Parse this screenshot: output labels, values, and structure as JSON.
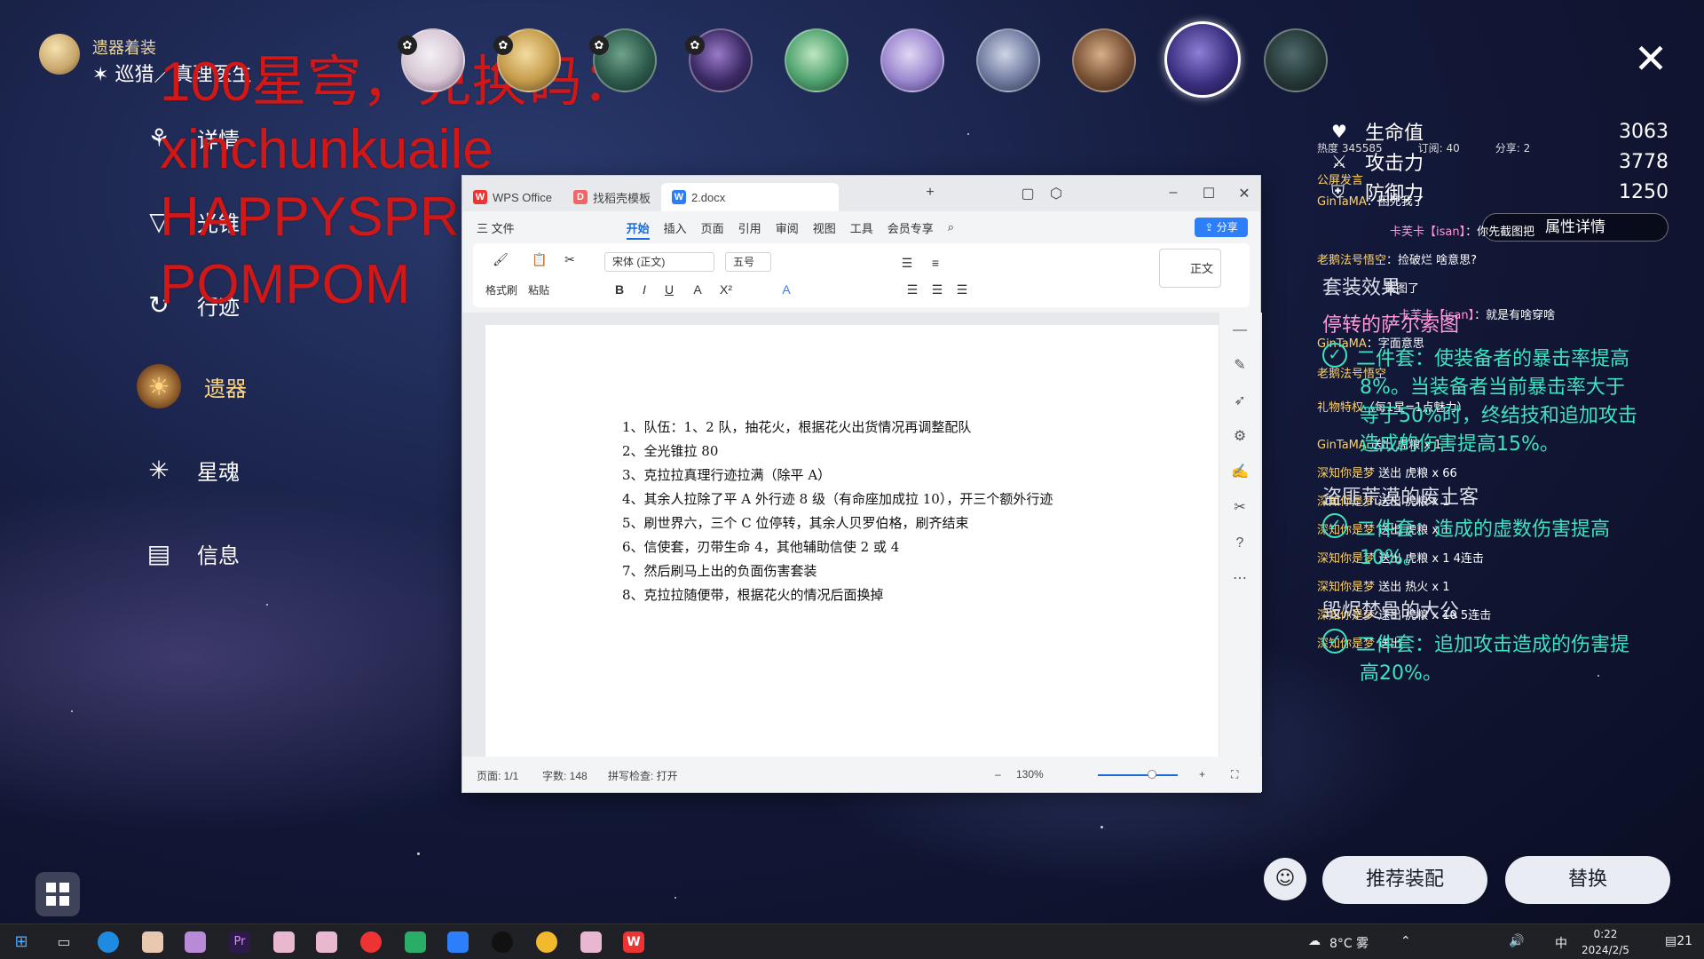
{
  "character": {
    "title": "遗器着装",
    "path": "巡猎／真理医生"
  },
  "overlay_text": [
    "100星穹，兑换码：",
    "xinchunkuaile",
    "HAPPYSPRINGFES",
    "POMPOM"
  ],
  "menu": [
    {
      "label": "详情",
      "icon": "detail-icon"
    },
    {
      "label": "光锥",
      "icon": "lightcone-icon"
    },
    {
      "label": "行迹",
      "icon": "trace-icon"
    },
    {
      "label": "遗器",
      "icon": "relic-icon",
      "active": true
    },
    {
      "label": "星魂",
      "icon": "eidolon-icon"
    },
    {
      "label": "信息",
      "icon": "info-icon"
    }
  ],
  "stats": [
    {
      "label": "生命值",
      "value": "3063",
      "icon": "heart-icon"
    },
    {
      "label": "攻击力",
      "value": "3778",
      "icon": "sword-icon"
    },
    {
      "label": "防御力",
      "value": "1250",
      "icon": "shield-icon"
    }
  ],
  "attr_detail_button": "属性详情",
  "live_stats": {
    "hot": "热度 345585",
    "sub": "订阅: 40",
    "share": "分享: 2"
  },
  "chat": [
    {
      "user": "公屏发言",
      "msg": ""
    },
    {
      "user": "GinTaMA",
      "msg": "：困死我了"
    },
    {
      "user": "卡芙卡【isan】",
      "msg": "：你先截图把"
    },
    {
      "user": "老鹅法号悟空",
      "msg": "：捡破烂 啥意思?"
    },
    {
      "user": "",
      "msg": "截图了"
    },
    {
      "user": "卡芙卡【isan】",
      "msg": "：就是有啥穿啥"
    },
    {
      "user": "GinTaMA",
      "msg": "：字面意思"
    },
    {
      "user": "老鹅法号悟空",
      "msg": ""
    },
    {
      "user": "礼物特权",
      "msg": "（每1星=1点魅力）"
    },
    {
      "user": "GinTaMA",
      "msg": "送出 虎粮 x 1"
    },
    {
      "user": "深知你是梦",
      "msg": "送出 虎粮 x 66"
    },
    {
      "user": "深知你是梦",
      "msg": "送出 虎粮 x 1"
    },
    {
      "user": "深知你是梦",
      "msg": "送出 虎粮 x 1"
    },
    {
      "user": "深知你是梦",
      "msg": "送出 虎粮 x 1 4连击"
    },
    {
      "user": "深知你是梦",
      "msg": "送出 热火 x 1"
    },
    {
      "user": "深知你是梦",
      "msg": "送出 虎粮 x 10 5连击"
    },
    {
      "user": "深知你是梦",
      "msg": "送出"
    }
  ],
  "sets": {
    "header": "套装效果",
    "groups": [
      {
        "name": "停转的萨尔索图",
        "lines": [
          "二件套：使装备者的暴击率提高",
          "8%。当装备者当前暴击率大于",
          "等于50%时，终结技和追加攻击",
          "造成的伤害提高15%。"
        ]
      },
      {
        "name": "盗匪荒漠的废土客",
        "lines": [
          "二件套：造成的虚数伤害提高",
          "10%。"
        ]
      },
      {
        "name": "毁烬焚骨的大公",
        "lines": [
          "二件套：追加攻击造成的伤害提",
          "高20%。"
        ]
      }
    ]
  },
  "buttons": {
    "recommend": "推荐装配",
    "replace": "替换"
  },
  "wps": {
    "tabs": [
      "WPS Office",
      "找稻壳模板",
      "2.docx"
    ],
    "menus": [
      "三 文件",
      "开始",
      "插入",
      "页面",
      "引用",
      "审阅",
      "视图",
      "工具",
      "会员专享"
    ],
    "active_menu": "开始",
    "share": "分享",
    "ribbon": {
      "format_painter": "格式刷",
      "paste": "粘贴",
      "font": "宋体 (正文)",
      "size": "五号",
      "style": "正文"
    },
    "doc_lines": [
      "1、队伍：1、2 队，抽花火，根据花火出货情况再调整配队",
      "2、全光锥拉 80",
      "3、克拉拉真理行迹拉满（除平 A）",
      "4、其余人拉除了平 A 外行迹 8 级（有命座加成拉 10），开三个额外行迹",
      "5、刷世界六，三个 C 位停转，其余人贝罗伯格，刷齐结束",
      "6、信使套，刃带生命 4，其他辅助信使 2 或 4",
      "7、然后刷马上出的负面伤害套装",
      "8、克拉拉随便带，根据花火的情况后面换掉"
    ],
    "status": {
      "page": "页面: 1/1",
      "words": "字数: 148",
      "spell": "拼写检查: 打开",
      "zoom": "130%"
    }
  },
  "taskbar": {
    "weather": "8°C 雾",
    "ime": "中",
    "time": "0:22",
    "date": "2024/2/5",
    "notif": "21"
  }
}
